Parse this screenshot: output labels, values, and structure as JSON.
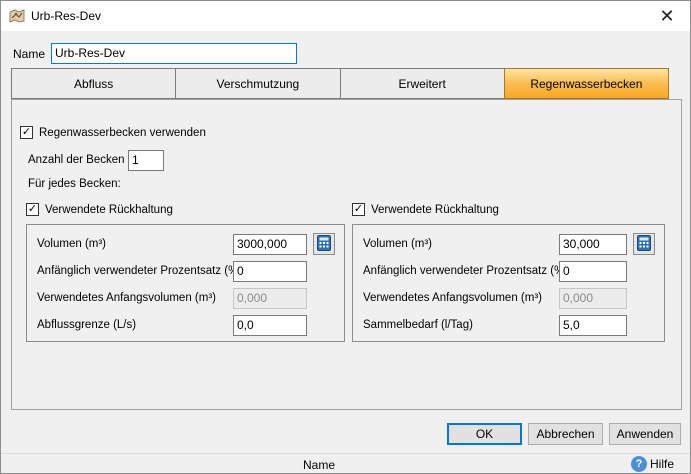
{
  "window": {
    "title": "Urb-Res-Dev",
    "close_glyph": "✕"
  },
  "name_field": {
    "label": "Name",
    "value": "Urb-Res-Dev"
  },
  "tabs": [
    {
      "label": "Abfluss",
      "active": false
    },
    {
      "label": "Verschmutzung",
      "active": false
    },
    {
      "label": "Erweitert",
      "active": false
    },
    {
      "label": "Regenwasserbecken",
      "active": true
    }
  ],
  "panel": {
    "use_tanks": {
      "label": "Regenwasserbecken verwenden",
      "checked": true
    },
    "tank_count": {
      "label": "Anzahl der Becken",
      "value": "1"
    },
    "per_tank_label": "Für jedes Becken:",
    "left": {
      "checkbox": {
        "label": "Verwendete Rückhaltung",
        "checked": true
      },
      "fields": [
        {
          "label": "Volumen (m³)",
          "value": "3000,000",
          "disabled": false
        },
        {
          "label": "Anfänglich verwendeter Prozentsatz (%)",
          "value": "0",
          "disabled": false
        },
        {
          "label": "Verwendetes Anfangsvolumen (m³)",
          "value": "0,000",
          "disabled": true
        },
        {
          "label": "Abflussgrenze (L/s)",
          "value": "0,0",
          "disabled": false
        }
      ]
    },
    "right": {
      "checkbox": {
        "label": "Verwendete Rückhaltung",
        "checked": true
      },
      "fields": [
        {
          "label": "Volumen (m³)",
          "value": "30,000",
          "disabled": false
        },
        {
          "label": "Anfänglich verwendeter Prozentsatz (%)",
          "value": "0",
          "disabled": false
        },
        {
          "label": "Verwendetes Anfangsvolumen (m³)",
          "value": "0,000",
          "disabled": true
        },
        {
          "label": "Sammelbedarf (l/Tag)",
          "value": "5,0",
          "disabled": false
        }
      ]
    }
  },
  "buttons": {
    "ok": "OK",
    "cancel": "Abbrechen",
    "apply": "Anwenden"
  },
  "status": {
    "text": "Name",
    "help_label": "Hilfe",
    "help_glyph": "?"
  },
  "colors": {
    "active_tab": "#fbbd4f",
    "focus_border": "#0078d7",
    "help_icon": "#4a90d9"
  },
  "icons": {
    "app": "map-icon",
    "calculator": "calculator-icon",
    "check": "✓"
  }
}
